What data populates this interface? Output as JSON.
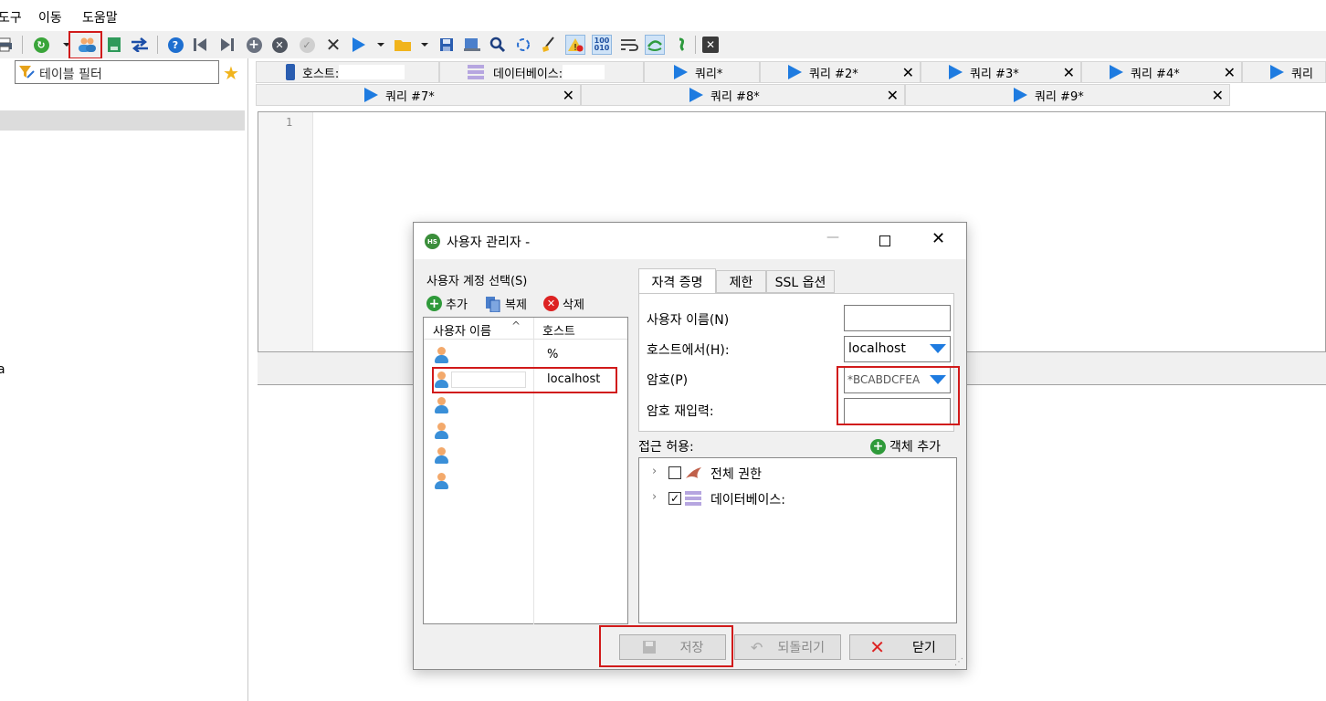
{
  "menu": [
    "도구",
    "이동",
    "도움말"
  ],
  "table_filter": {
    "placeholder": "테이블 필터"
  },
  "tabs_row1": [
    {
      "label": "호스트:",
      "icon": "server-icon"
    },
    {
      "label": "데이터베이스:",
      "icon": "database-icon"
    },
    {
      "label": "쿼리*",
      "icon": "play-icon"
    },
    {
      "label": "쿼리 #2*",
      "icon": "play-icon"
    },
    {
      "label": "쿼리 #3*",
      "icon": "play-icon"
    },
    {
      "label": "쿼리 #4*",
      "icon": "play-icon"
    },
    {
      "label": "쿼리",
      "icon": "play-icon"
    }
  ],
  "tabs_row2": [
    {
      "label": "쿼리 #7*"
    },
    {
      "label": "쿼리 #8*"
    },
    {
      "label": "쿼리 #9*"
    }
  ],
  "editor": {
    "line_number": "1"
  },
  "left_fragment": "a",
  "dialog": {
    "title": "사용자 관리자 -",
    "account_select_label": "사용자 계정 선택(S)",
    "add_label": "추가",
    "clone_label": "복제",
    "delete_label": "삭제",
    "columns": [
      "사용자 이름",
      "호스트"
    ],
    "rows": [
      {
        "host": "%"
      },
      {
        "host": "localhost"
      },
      {
        "host": ""
      },
      {
        "host": ""
      },
      {
        "host": ""
      },
      {
        "host": ""
      }
    ],
    "tabs": [
      "자격 증명",
      "제한",
      "SSL 옵션"
    ],
    "username_label": "사용자 이름(N)",
    "host_label": "호스트에서(H):",
    "host_value": "localhost",
    "password_label": "암호(P)",
    "password_value": "*BCABDCFEA",
    "password_repeat_label": "암호 재입력:",
    "access_label": "접근 허용:",
    "add_object_label": "객체 추가",
    "tree": [
      {
        "label": "전체 권한",
        "checked": false
      },
      {
        "label": "데이터베이스:",
        "checked": true
      }
    ],
    "buttons": {
      "save": "저장",
      "revert": "되돌리기",
      "close": "닫기"
    }
  },
  "colors": {
    "highlight_box": "#d11a1a",
    "accent_blue": "#1e7be0"
  }
}
